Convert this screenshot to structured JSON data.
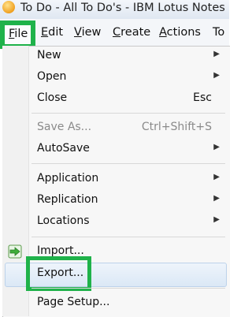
{
  "window": {
    "title": "To Do - All To Do's - IBM Lotus Notes"
  },
  "menubar": {
    "file": {
      "accel": "F",
      "rest": "ile"
    },
    "edit": {
      "accel": "E",
      "rest": "dit"
    },
    "view": {
      "accel": "V",
      "rest": "iew"
    },
    "create": {
      "accel": "C",
      "rest": "reate"
    },
    "actions": {
      "accel": "A",
      "rest": "ctions"
    },
    "tools": "To"
  },
  "file_menu": {
    "new": "New",
    "open": "Open",
    "close": {
      "label": "Close",
      "shortcut": "Esc"
    },
    "save_as": {
      "label": "Save As...",
      "shortcut": "Ctrl+Shift+S"
    },
    "autosave": "AutoSave",
    "application": "Application",
    "replication": "Replication",
    "locations": "Locations",
    "import": "Import...",
    "export": "Export...",
    "page_setup": "Page Setup..."
  },
  "icons": {
    "app": "lotus-notes-icon",
    "import": "import-arrow-icon",
    "submenu": "chevron-right-icon"
  },
  "colors": {
    "highlight": "#1fb24a",
    "hover": "#dbe8f6"
  }
}
